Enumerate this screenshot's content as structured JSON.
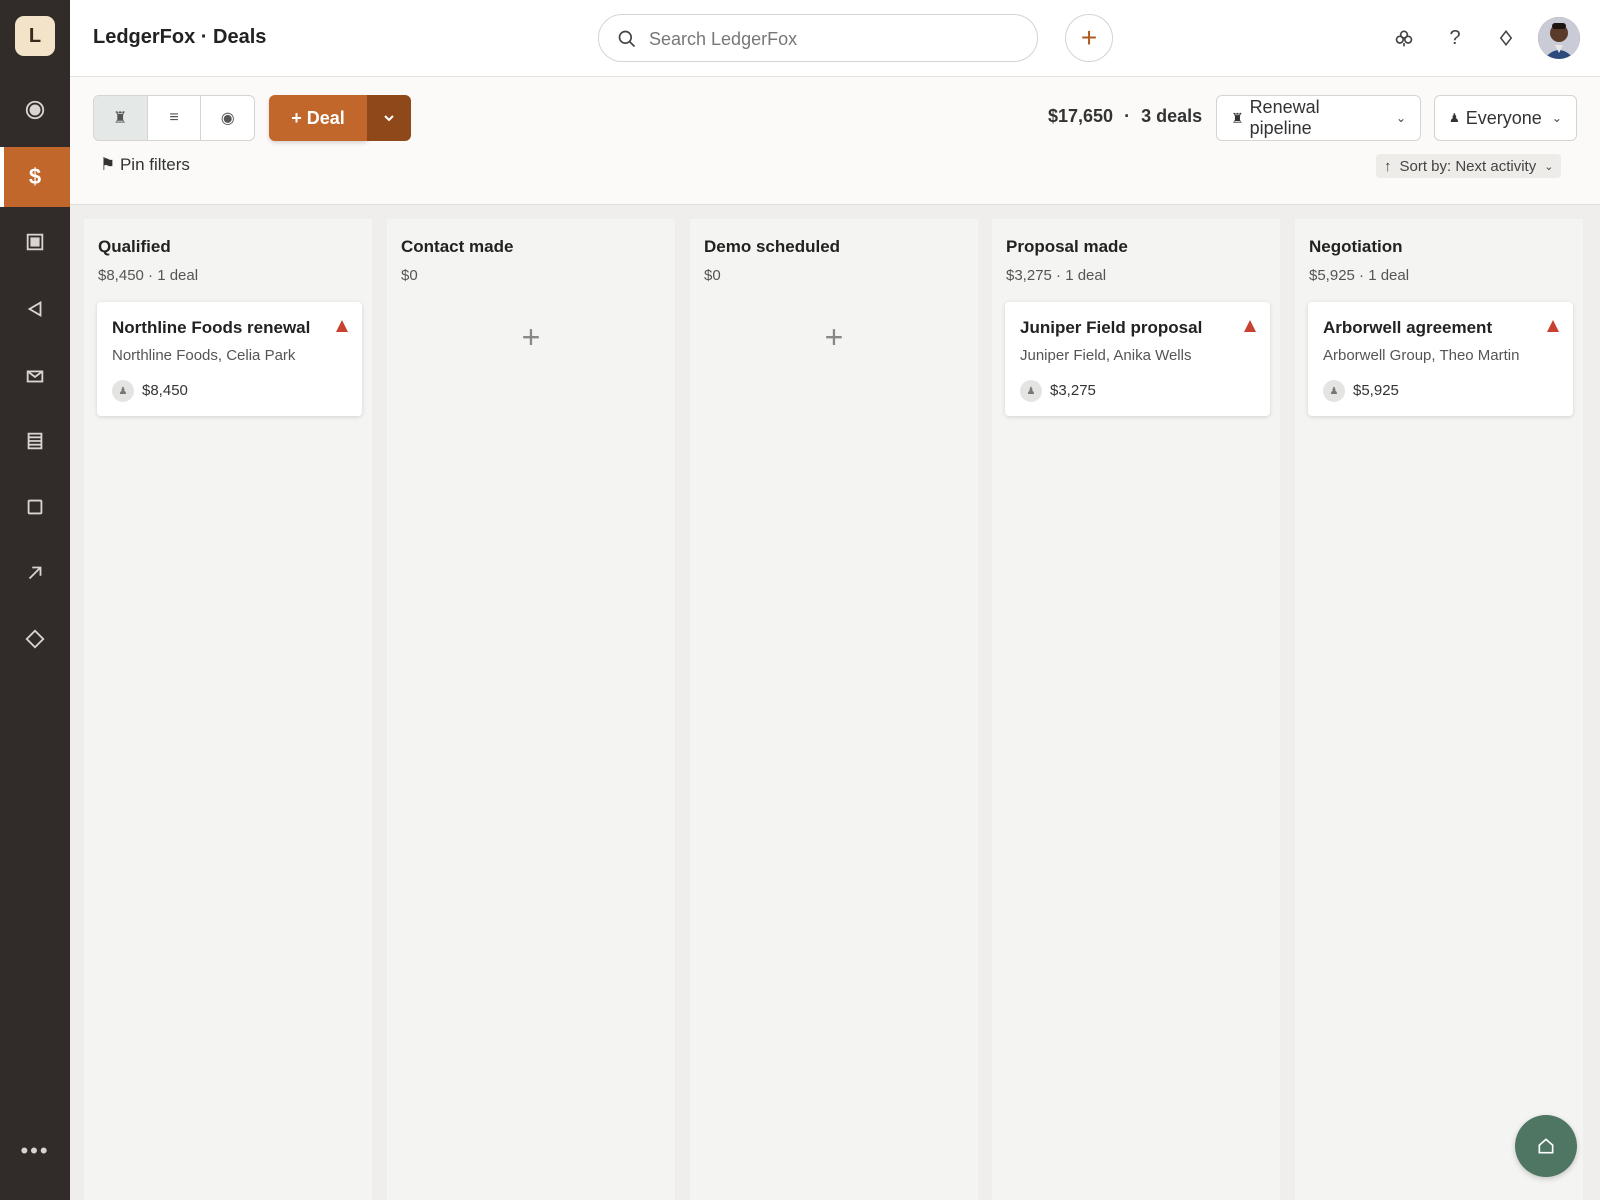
{
  "app": {
    "logo_letter": "L",
    "title": "LedgerFox · Deals"
  },
  "sidebar": {
    "items": [
      {
        "name": "activity",
        "icon": "target-icon"
      },
      {
        "name": "deals",
        "icon": "dollar-icon",
        "label": "$",
        "active": true
      },
      {
        "name": "leads",
        "icon": "inbox-icon"
      },
      {
        "name": "campaigns",
        "icon": "megaphone-icon"
      },
      {
        "name": "mail",
        "icon": "mail-icon"
      },
      {
        "name": "reports",
        "icon": "list-icon"
      },
      {
        "name": "projects",
        "icon": "square-icon"
      },
      {
        "name": "insights",
        "icon": "arrow-up-right-icon"
      },
      {
        "name": "products",
        "icon": "diamond-icon"
      }
    ],
    "more": "•••"
  },
  "topbar": {
    "search_placeholder": "Search LedgerFox",
    "add_symbol": "+",
    "icons": [
      "extensions-icon",
      "help-icon",
      "upgrade-diamond-icon"
    ],
    "help_glyph": "?"
  },
  "toolbar": {
    "view_modes": [
      "pipeline-view",
      "list-view",
      "forecast-view"
    ],
    "deal_button": "+ Deal",
    "pin_filters": "⚑ Pin filters",
    "summary_value": "$17,650",
    "summary_sep": "·",
    "summary_count": "3 deals",
    "pipeline": "Renewal pipeline",
    "owner": "Everyone",
    "sort": "Sort by: Next activity"
  },
  "columns": [
    {
      "title": "Qualified",
      "summary": "$8,450 · 1 deal",
      "card": {
        "title": "Northline Foods renewal",
        "org": "Northline Foods, Celia Park",
        "value": "$8,450"
      }
    },
    {
      "title": "Contact made",
      "summary": "$0",
      "add": "+"
    },
    {
      "title": "Demo scheduled",
      "summary": "$0",
      "add": "+"
    },
    {
      "title": "Proposal made",
      "summary": "$3,275 · 1 deal",
      "card": {
        "title": "Juniper Field proposal",
        "org": "Juniper Field, Anika Wells",
        "value": "$3,275"
      }
    },
    {
      "title": "Negotiation",
      "summary": "$5,925 · 1 deal",
      "card": {
        "title": "Arborwell agreement",
        "org": "Arborwell Group, Theo Martin",
        "value": "$5,925"
      }
    }
  ],
  "colors": {
    "accent": "#c1672b",
    "accent_dark": "#8f4819",
    "sidebar_bg": "#312b29",
    "warning": "#c8402f",
    "fab": "#4f7563"
  }
}
